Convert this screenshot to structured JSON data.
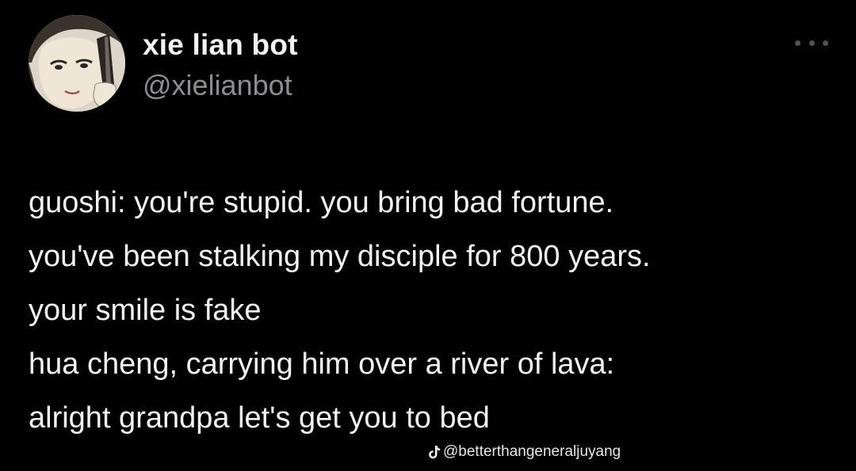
{
  "tweet": {
    "display_name": "xie lian bot",
    "handle": "@xielianbot",
    "avatar_icon": "avatar-anime-character-icon",
    "more_icon": "more-horizontal-icon",
    "lines": [
      "guoshi: you're stupid. you bring bad fortune.",
      "you've been stalking my disciple for 800 years.",
      "your smile is fake",
      "hua cheng, carrying him over a river of lava:",
      "alright grandpa let's get you to bed"
    ]
  },
  "watermark": {
    "icon": "tiktok-icon",
    "handle": "@betterthangeneraljuyang"
  },
  "colors": {
    "background": "#000000",
    "text": "#f2f2f2",
    "handle": "#8b8f93",
    "more_dots": "#4f5357"
  }
}
